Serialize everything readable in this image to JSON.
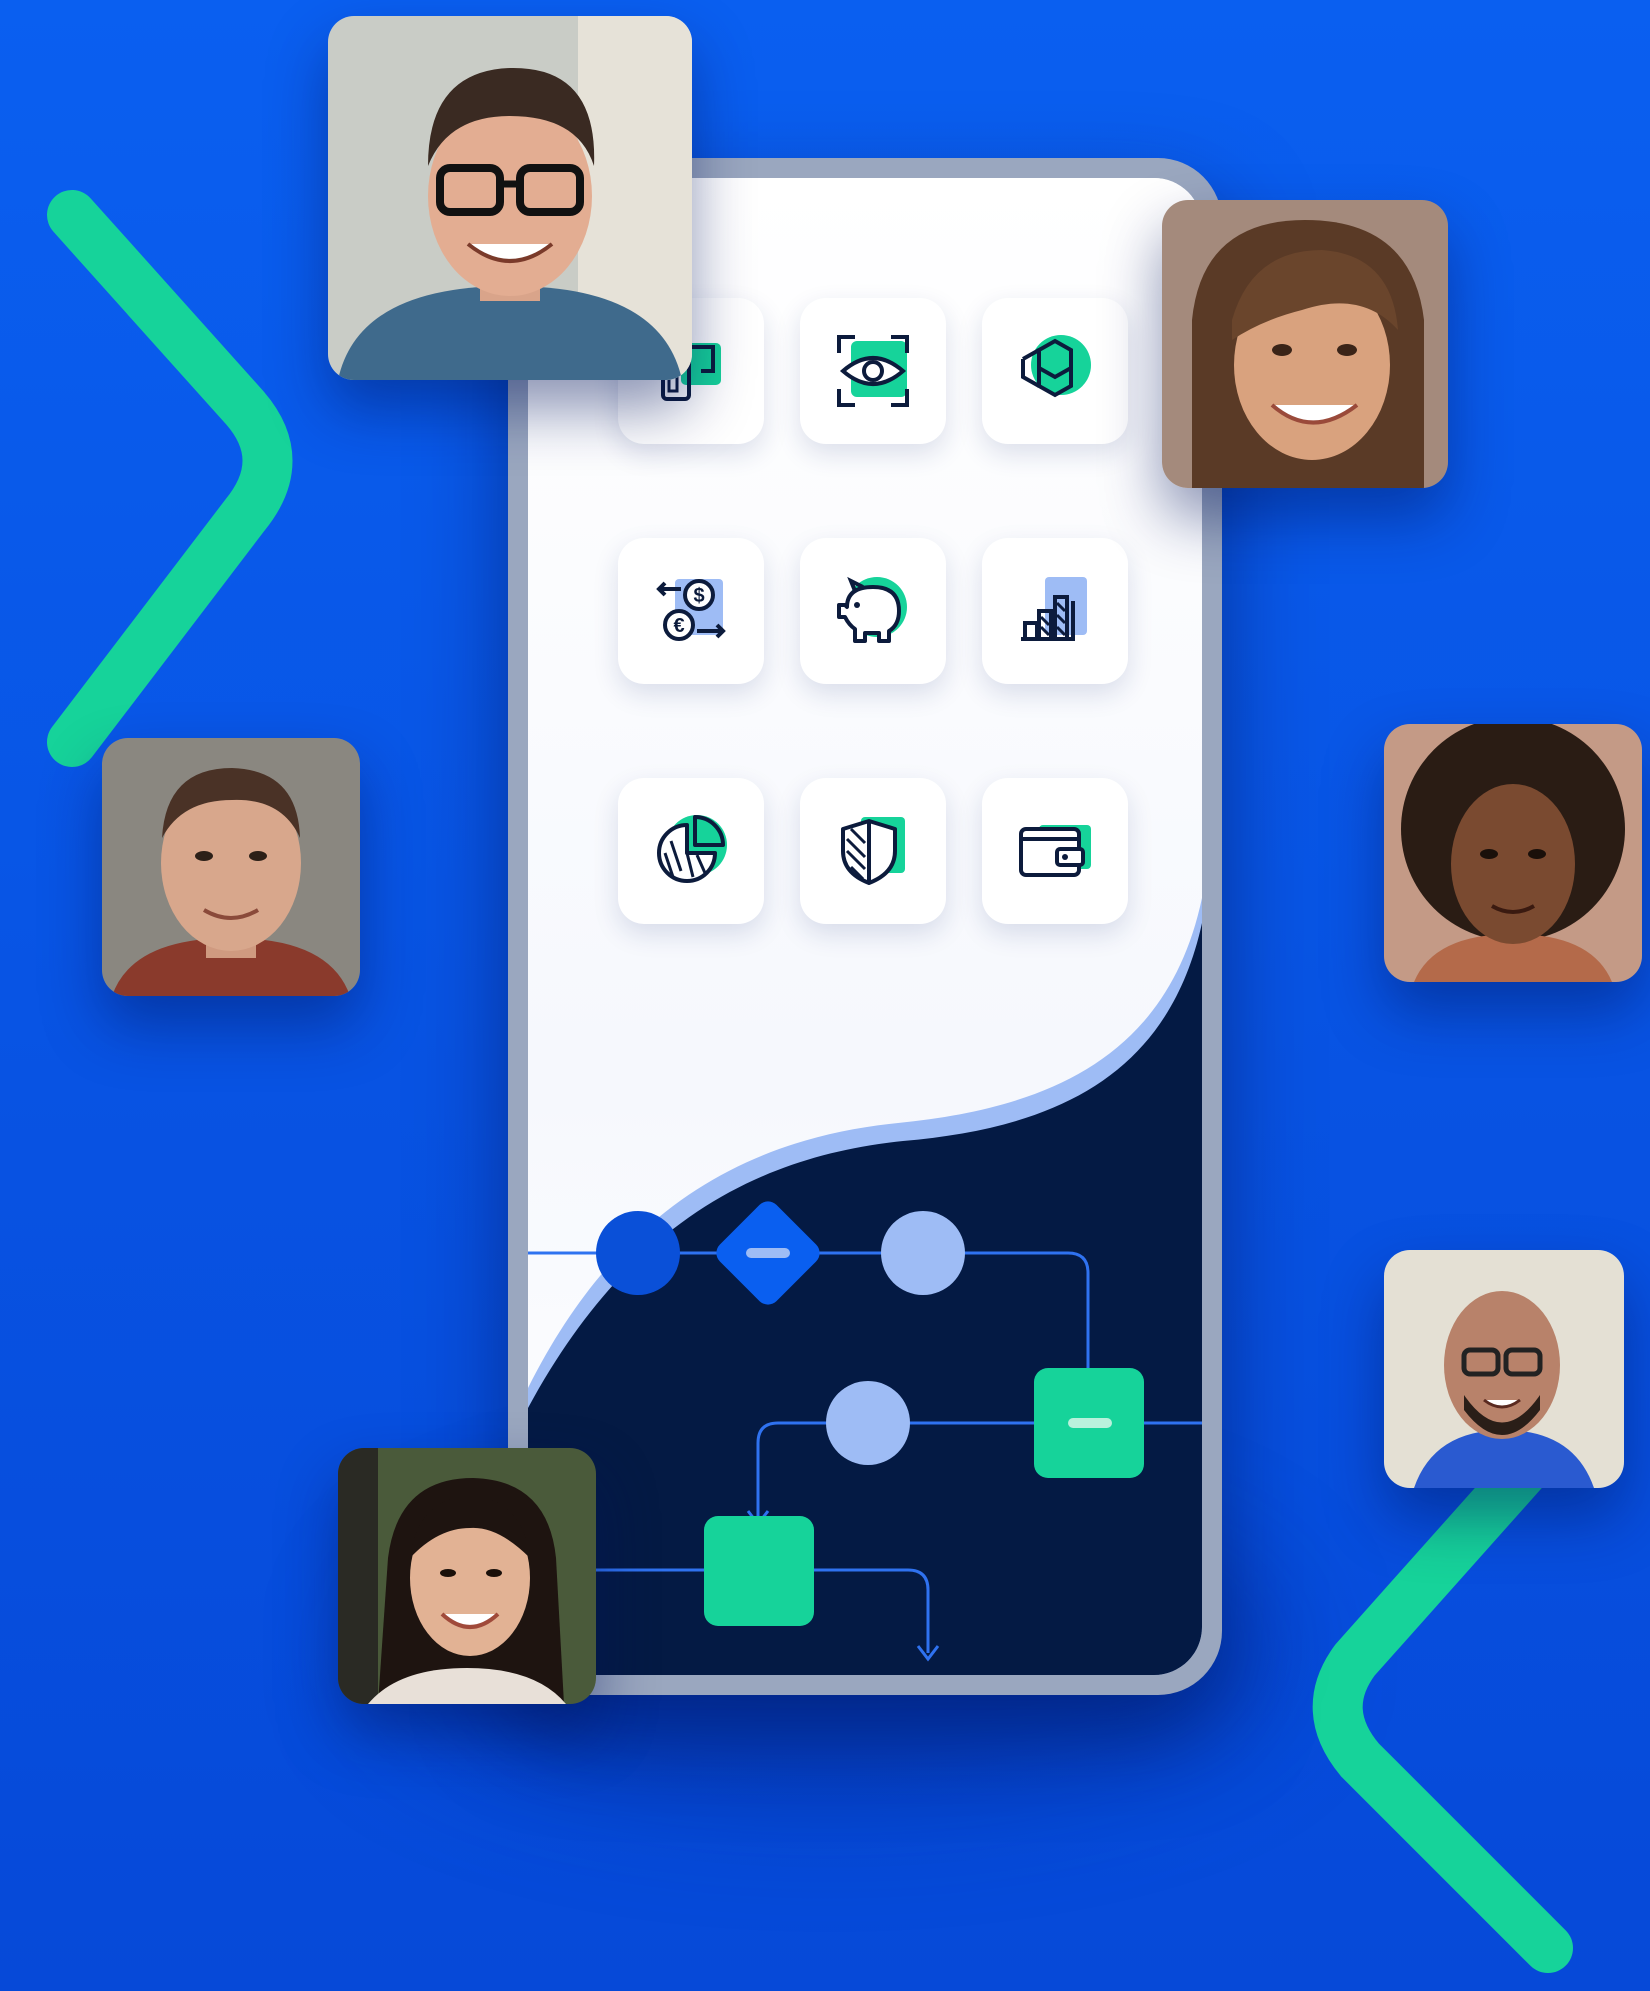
{
  "colors": {
    "background": "#0a5ff0",
    "background_dark": "#0648d0",
    "accent_green": "#16d39a",
    "navy": "#041a44",
    "light_blue": "#9ebcf5",
    "icon_stroke": "#0c1b3c",
    "phone_frame": "#9aa7bf"
  },
  "app_icons": [
    "card-payment-icon",
    "face-scan-icon",
    "blockchain-icon",
    "currency-exchange-icon",
    "piggy-bank-icon",
    "growth-chart-icon",
    "pie-chart-icon",
    "security-shield-icon",
    "wallet-icon"
  ],
  "people": [
    "man-with-glasses-photo",
    "smiling-woman-photo",
    "man-portrait-photo",
    "curly-hair-woman-photo",
    "bald-man-photo",
    "young-woman-photo"
  ]
}
